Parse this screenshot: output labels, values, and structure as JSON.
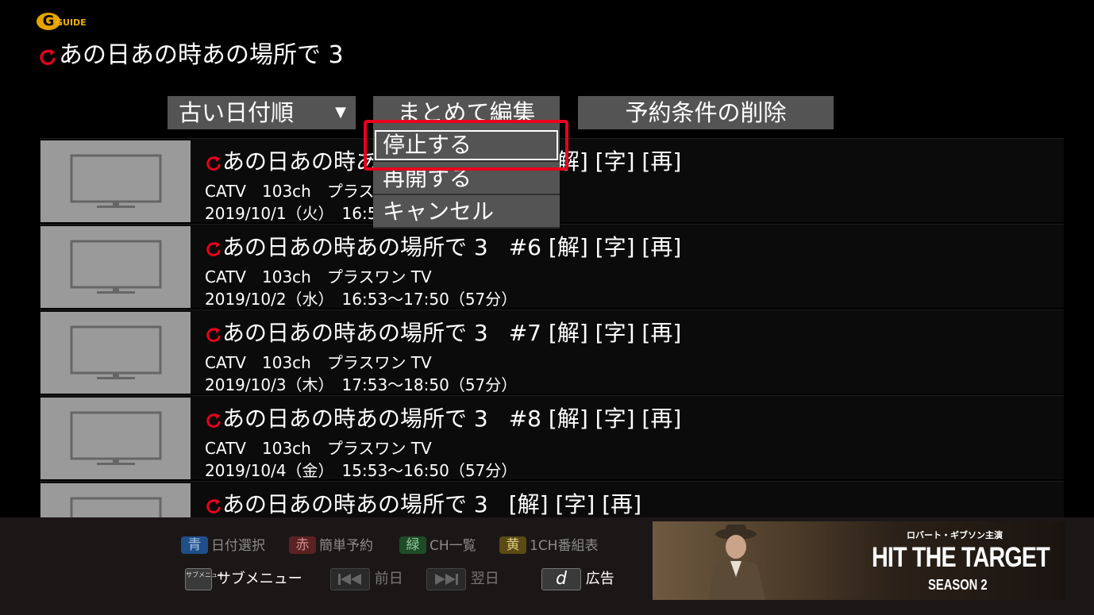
{
  "logo": {
    "mark": "G",
    "text": "GUIDE"
  },
  "header": {
    "title": "あの日あの時あの場所で 3"
  },
  "toolbar": {
    "sort_label": "古い日付順",
    "sort_caret": "▼",
    "batch_edit_label": "まとめて編集",
    "delete_condition_label": "予約条件の削除"
  },
  "dropdown": {
    "items": [
      {
        "label": "停止する"
      },
      {
        "label": "再開する"
      },
      {
        "label": "キャンセル"
      }
    ]
  },
  "list": {
    "rows": [
      {
        "title": "あの日あの時あの場所で 3",
        "tags": "#5 [解] [字] [再]",
        "channel": "CATV　103ch　プラスワン TV",
        "time": "2019/10/1（火）　16:53～17:50（57分）"
      },
      {
        "title": "あの日あの時あの場所で 3",
        "tags": "#6 [解] [字] [再]",
        "channel": "CATV　103ch　プラスワン TV",
        "time": "2019/10/2（水）　16:53～17:50（57分）"
      },
      {
        "title": "あの日あの時あの場所で 3",
        "tags": "#7 [解] [字] [再]",
        "channel": "CATV　103ch　プラスワン TV",
        "time": "2019/10/3（木）　17:53～18:50（57分）"
      },
      {
        "title": "あの日あの時あの場所で 3",
        "tags": "#8 [解] [字] [再]",
        "channel": "CATV　103ch　プラスワン TV",
        "time": "2019/10/4（金）　15:53～16:50（57分）"
      },
      {
        "title": "あの日あの時あの場所で 3",
        "tags": "[解] [字] [再]",
        "channel": "",
        "time": ""
      }
    ]
  },
  "footer": {
    "color_keys": [
      {
        "key": "青",
        "label": "日付選択",
        "color": "#1e5fa8"
      },
      {
        "key": "赤",
        "label": "簡単予約",
        "color": "#b0282a"
      },
      {
        "key": "緑",
        "label": "CH一覧",
        "color": "#2a8a3a"
      },
      {
        "key": "黄",
        "label": "1CH番組表",
        "color": "#c9a21a"
      }
    ],
    "sub_menu": {
      "key": "サブメニュー",
      "label": "サブメニュー"
    },
    "prev_day": {
      "label": "前日"
    },
    "next_day": {
      "label": "翌日"
    },
    "d_button": {
      "key": "d",
      "label": "広告"
    }
  },
  "ad": {
    "subtitle": "ロバート・ギブソン主演",
    "title": "HIT THE TARGET",
    "season": "SEASON 2"
  },
  "colors": {
    "focus": "#e8001c",
    "accent": "#e8a300",
    "button": "#545454"
  }
}
